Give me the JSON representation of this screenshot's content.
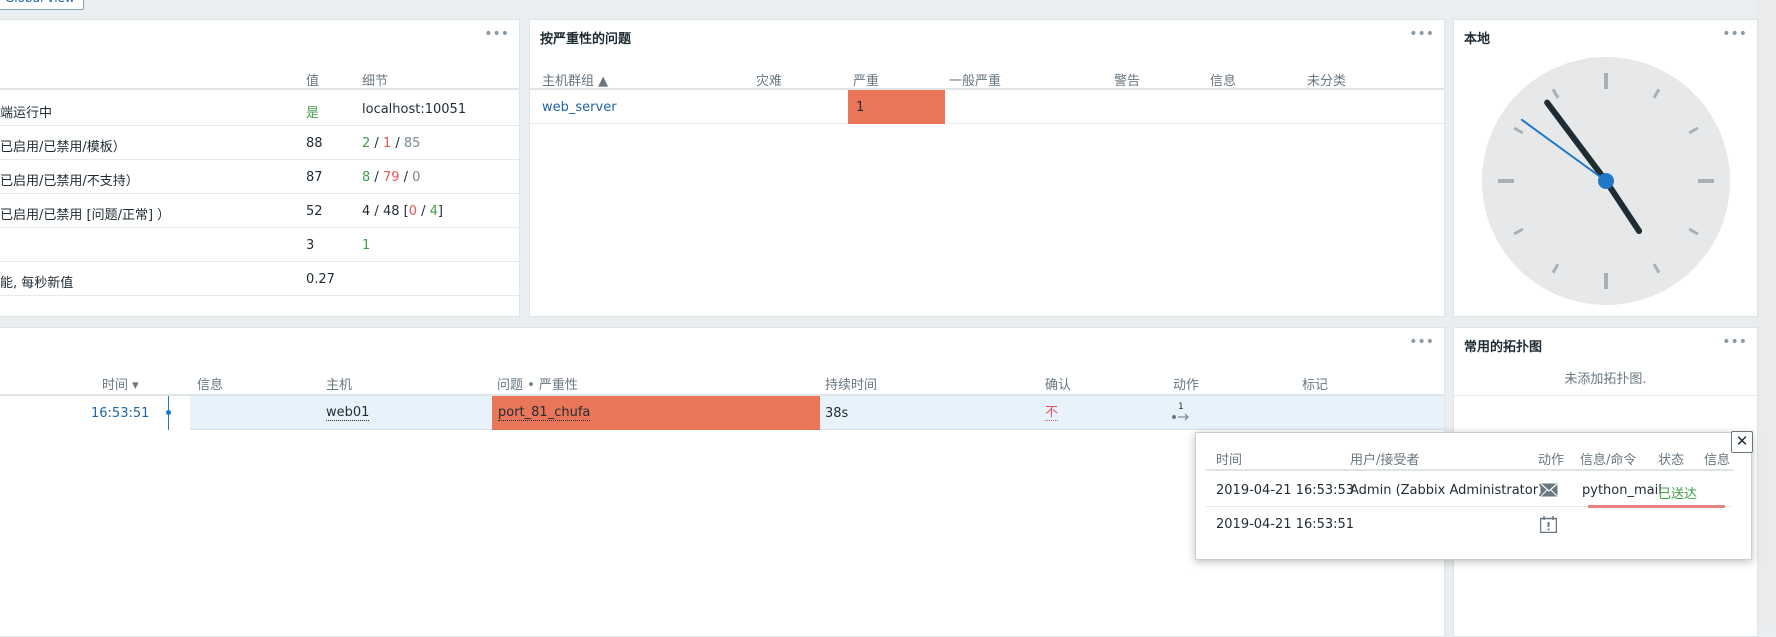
{
  "top": {
    "global_view": "Global view"
  },
  "system_info": {
    "columns": {
      "value": "值",
      "details": "细节"
    },
    "rows": [
      {
        "param": "端运行中",
        "value": "是",
        "details": "localhost:10051"
      },
      {
        "param": "已启用/已禁用/模板）",
        "value": "88",
        "d1": "2",
        "d2": "1",
        "d3": "85"
      },
      {
        "param": "已启用/已禁用/不支持）",
        "value": "87",
        "d1": "8",
        "d2": "79",
        "d3": "0"
      },
      {
        "param": "已启用/已禁用 [问题/正常] ）",
        "value": "52",
        "d1": "4",
        "d2": "48",
        "d3": "0",
        "d4": "4"
      },
      {
        "param": "",
        "value": "3",
        "d1": "1"
      },
      {
        "param": "能, 每秒新值",
        "value": "0.27"
      }
    ]
  },
  "severity": {
    "title": "按严重性的问题",
    "columns": {
      "group": "主机群组 ▲",
      "disaster": "灾难",
      "high": "严重",
      "average": "一般严重",
      "warning": "警告",
      "info": "信息",
      "nc": "未分类"
    },
    "row": {
      "group": "web_server",
      "high": "1"
    },
    "high_color": "#e97659"
  },
  "clock": {
    "title": "本地",
    "hour": 4,
    "minute": 53,
    "second": 51
  },
  "problems": {
    "columns": {
      "time": "时间 ▾",
      "info": "信息",
      "host": "主机",
      "problem": "问题 • 严重性",
      "duration": "持续时间",
      "ack": "确认",
      "actions": "动作",
      "tags": "标记"
    },
    "row": {
      "time": "16:53:51",
      "host": "web01",
      "problem": "port_81_chufa",
      "duration": "38s",
      "ack": "不",
      "action_count": "1"
    }
  },
  "maps": {
    "title": "常用的拓扑图",
    "empty": "未添加拓扑图."
  },
  "popup": {
    "columns": {
      "time": "时间",
      "user": "用户/接受者",
      "action": "动作",
      "message": "信息/命令",
      "status": "状态",
      "info": "信息"
    },
    "rows": [
      {
        "time": "2019-04-21 16:53:53",
        "user": "Admin (Zabbix Administrator)",
        "action_icon": "envelope-icon",
        "message": "python_mail",
        "status": "已送达"
      },
      {
        "time": "2019-04-21 16:53:51",
        "action_icon": "calendar-alert-icon"
      }
    ]
  }
}
